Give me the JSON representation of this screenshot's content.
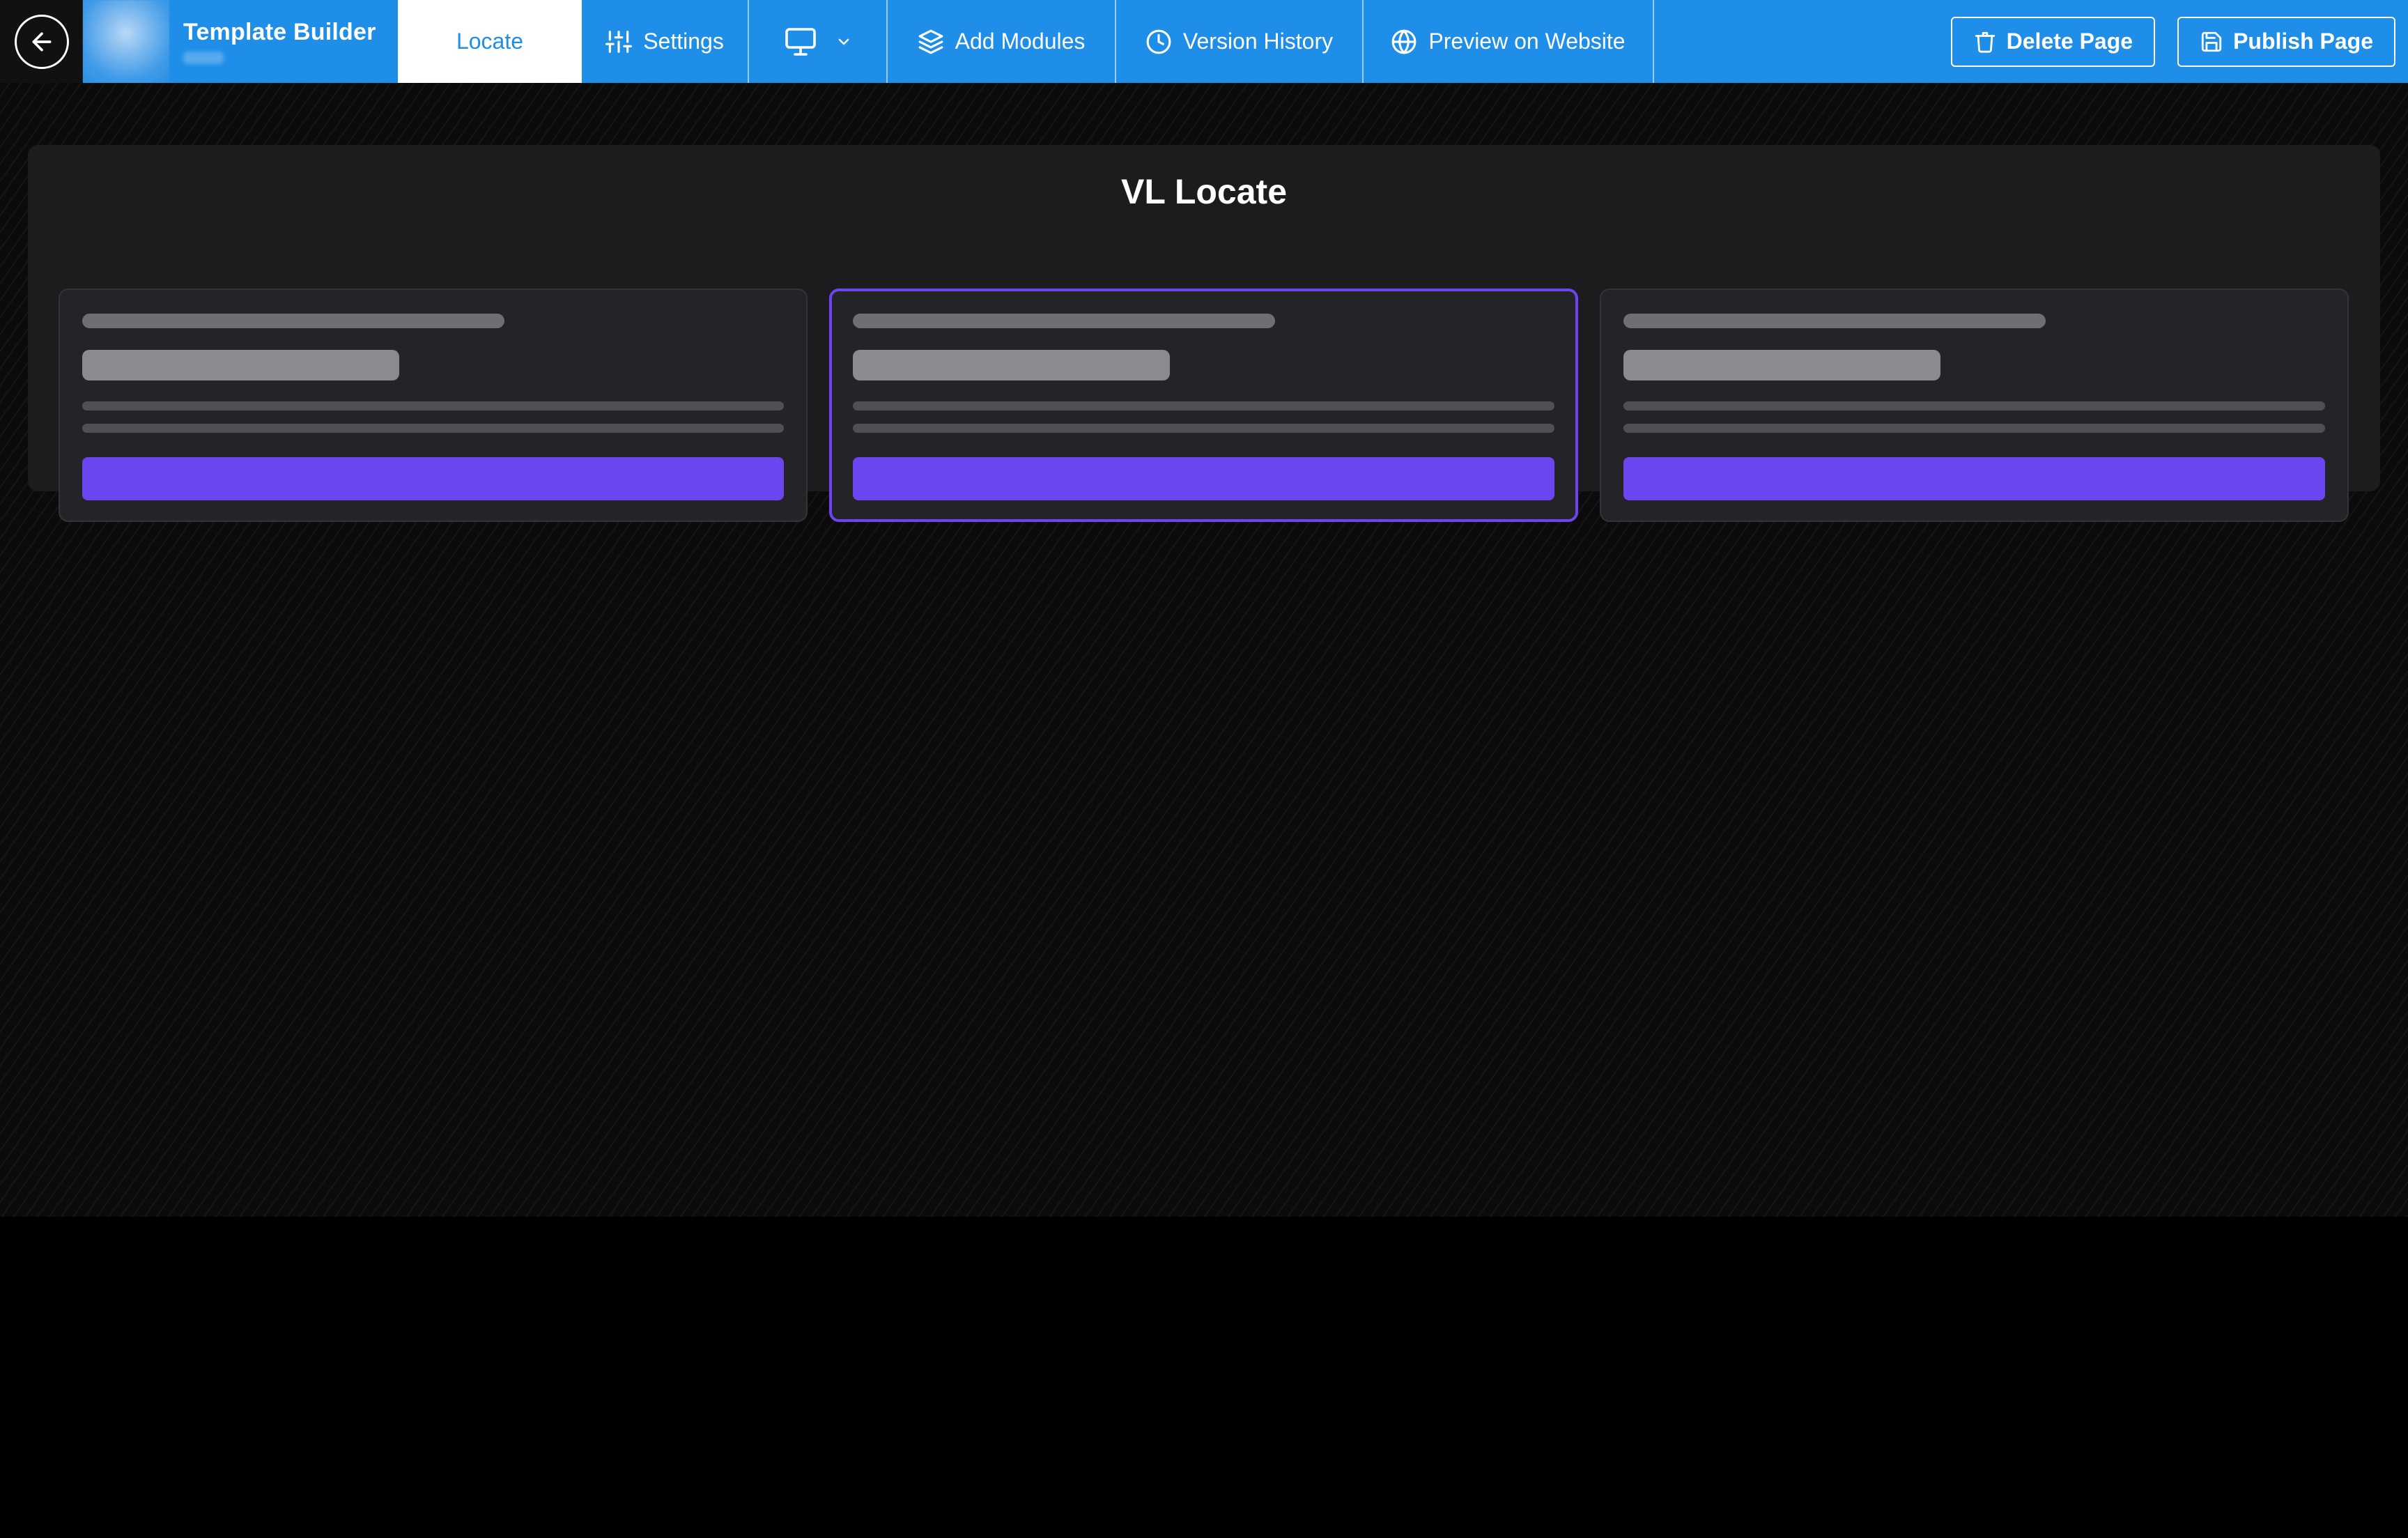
{
  "header": {
    "back_icon": "arrow-left-icon",
    "title": "Template Builder",
    "active_tab": "Locate",
    "nav": {
      "settings": "Settings",
      "device_icon": "monitor-icon",
      "add_modules": "Add Modules",
      "version_history": "Version History",
      "preview": "Preview on Website"
    },
    "delete_page": "Delete Page",
    "publish_page": "Publish Page"
  },
  "module": {
    "title": "VL Locate",
    "card_count": 3,
    "selected_card_index": 1
  },
  "colors": {
    "topbar": "#1e8ee8",
    "accent": "#6b46f0",
    "canvas": "#0b0b0b",
    "module_bg": "#1c1c1f",
    "card_bg": "#232328"
  }
}
